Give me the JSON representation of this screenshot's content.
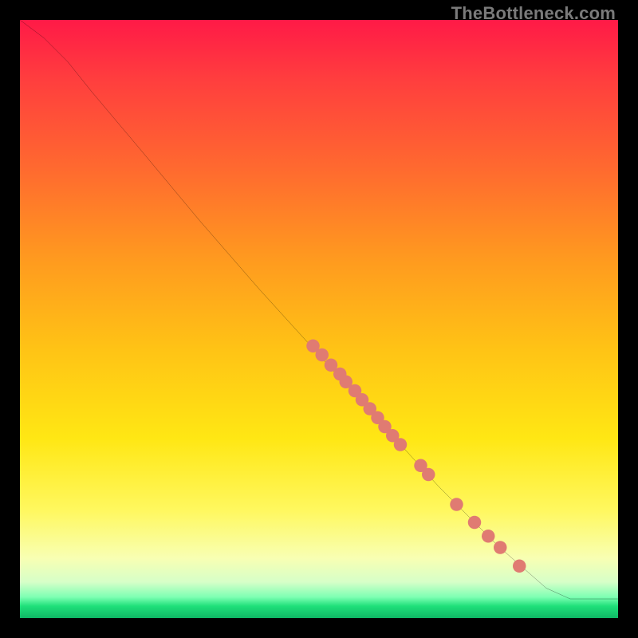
{
  "watermark": "TheBottleneck.com",
  "chart_data": {
    "type": "line",
    "title": "",
    "xlabel": "",
    "ylabel": "",
    "xlim": [
      0,
      100
    ],
    "ylim": [
      0,
      100
    ],
    "curve_comment": "Monotonically decreasing line from top-left toward bottom-right, with gentle initial shoulder and a flat tail near the bottom.",
    "curve": [
      {
        "x": 0,
        "y": 100
      },
      {
        "x": 4,
        "y": 97
      },
      {
        "x": 8,
        "y": 93
      },
      {
        "x": 12,
        "y": 88
      },
      {
        "x": 20,
        "y": 78.5
      },
      {
        "x": 30,
        "y": 66.5
      },
      {
        "x": 40,
        "y": 55
      },
      {
        "x": 50,
        "y": 44
      },
      {
        "x": 60,
        "y": 33
      },
      {
        "x": 70,
        "y": 22
      },
      {
        "x": 80,
        "y": 12
      },
      {
        "x": 88,
        "y": 5
      },
      {
        "x": 92,
        "y": 3.2
      },
      {
        "x": 95,
        "y": 3.2
      },
      {
        "x": 100,
        "y": 3.2
      }
    ],
    "markers_comment": "Salmon/coral dot markers clustered along the line roughly in the mid-to-lower region.",
    "markers": [
      {
        "x": 49,
        "y": 45.5
      },
      {
        "x": 50.5,
        "y": 44
      },
      {
        "x": 52,
        "y": 42.3
      },
      {
        "x": 53.5,
        "y": 40.8
      },
      {
        "x": 54.5,
        "y": 39.5
      },
      {
        "x": 56,
        "y": 38
      },
      {
        "x": 57.2,
        "y": 36.5
      },
      {
        "x": 58.5,
        "y": 35
      },
      {
        "x": 59.8,
        "y": 33.5
      },
      {
        "x": 61,
        "y": 32
      },
      {
        "x": 62.3,
        "y": 30.5
      },
      {
        "x": 63.6,
        "y": 29
      },
      {
        "x": 67,
        "y": 25.5
      },
      {
        "x": 68.3,
        "y": 24
      },
      {
        "x": 73,
        "y": 19
      },
      {
        "x": 76,
        "y": 16
      },
      {
        "x": 78.3,
        "y": 13.7
      },
      {
        "x": 80.3,
        "y": 11.8
      },
      {
        "x": 83.5,
        "y": 8.7
      }
    ],
    "marker_color": "#e07b72",
    "line_color": "#000000"
  }
}
